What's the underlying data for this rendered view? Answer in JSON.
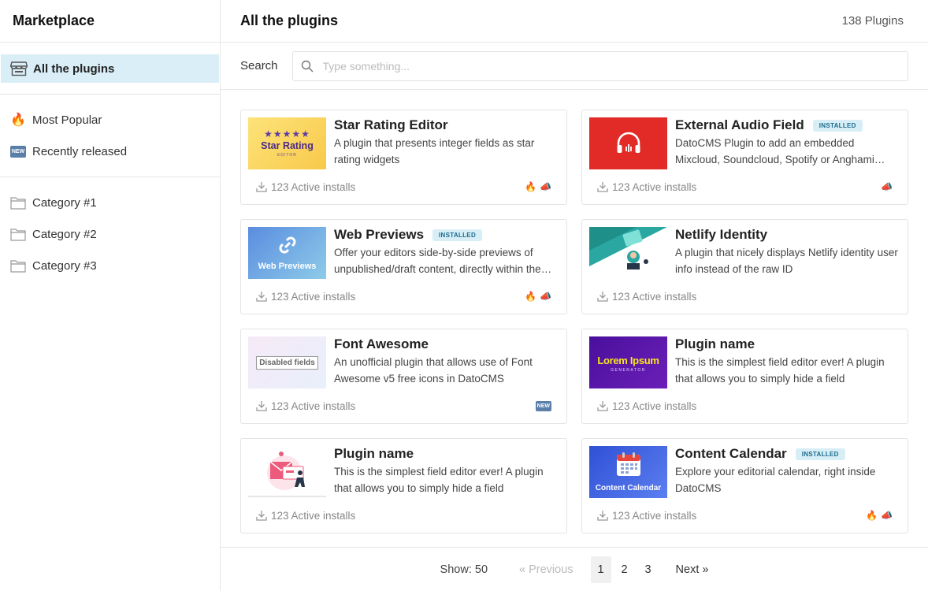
{
  "sidebar": {
    "title": "Marketplace",
    "all_label": "All the plugins",
    "filters": [
      {
        "label": "Most Popular",
        "icon": "fire-icon"
      },
      {
        "label": "Recently released",
        "icon": "new-icon"
      }
    ],
    "new_badge": "NEW",
    "categories": [
      {
        "label": "Category #1"
      },
      {
        "label": "Category #2"
      },
      {
        "label": "Category #3"
      }
    ]
  },
  "header": {
    "title": "All the plugins",
    "count": "138 Plugins"
  },
  "search": {
    "label": "Search",
    "placeholder": "Type something..."
  },
  "plugins": [
    {
      "title": "Star Rating Editor",
      "installed": false,
      "badge": "",
      "desc": "A plugin that presents integer fields as star rating widgets",
      "installs": "123 Active installs",
      "thumb_text": "Star Rating",
      "thumb_sub": "EDITOR",
      "thumb_stars": "★★★★★"
    },
    {
      "title": "External Audio Field",
      "installed": true,
      "badge": "INSTALLED",
      "desc": "DatoCMS Plugin to add an embedded Mixcloud, Soundcloud, Spotify or Anghami player",
      "installs": "123 Active installs"
    },
    {
      "title": "Web Previews",
      "installed": true,
      "badge": "INSTALLED",
      "desc": "Offer your editors side-by-side previews of unpublished/draft content, directly within the record",
      "installs": "123 Active installs",
      "thumb_text": "Web Previews"
    },
    {
      "title": "Netlify Identity",
      "installed": false,
      "badge": "",
      "desc": "A plugin that nicely displays Netlify identity user info instead of the raw ID",
      "installs": "123 Active installs"
    },
    {
      "title": "Font Awesome",
      "installed": false,
      "badge": "",
      "desc": "An unofficial plugin that allows use of Font Awesome v5 free icons in DatoCMS",
      "installs": "123 Active installs",
      "thumb_text": "Disabled fields",
      "tag_new": "NEW"
    },
    {
      "title": "Plugin name",
      "installed": false,
      "badge": "",
      "desc": "This is the simplest field editor ever! A plugin that allows you to simply hide a field",
      "installs": "123 Active installs",
      "thumb_text": "Lorem Ipsum",
      "thumb_sub": "GENERATOR"
    },
    {
      "title": "Plugin name",
      "installed": false,
      "badge": "",
      "desc": "This is the simplest field editor ever! A plugin that allows you to simply hide a field",
      "installs": "123 Active installs"
    },
    {
      "title": "Content Calendar",
      "installed": true,
      "badge": "INSTALLED",
      "desc": "Explore your editorial calendar, right inside DatoCMS",
      "installs": "123 Active installs",
      "thumb_text": "Content Calendar"
    }
  ],
  "pager": {
    "show": "Show: 50",
    "prev": "« Previous",
    "pages": [
      "1",
      "2",
      "3"
    ],
    "next": "Next »"
  },
  "colors": {
    "active_bg": "#d9eef7",
    "badge_bg": "#d7eef7",
    "badge_text": "#1b6b8c",
    "audio_red": "#e22b26",
    "calendar_blue": "#3d5bd9",
    "lorem_purple": "#5b12a8"
  }
}
